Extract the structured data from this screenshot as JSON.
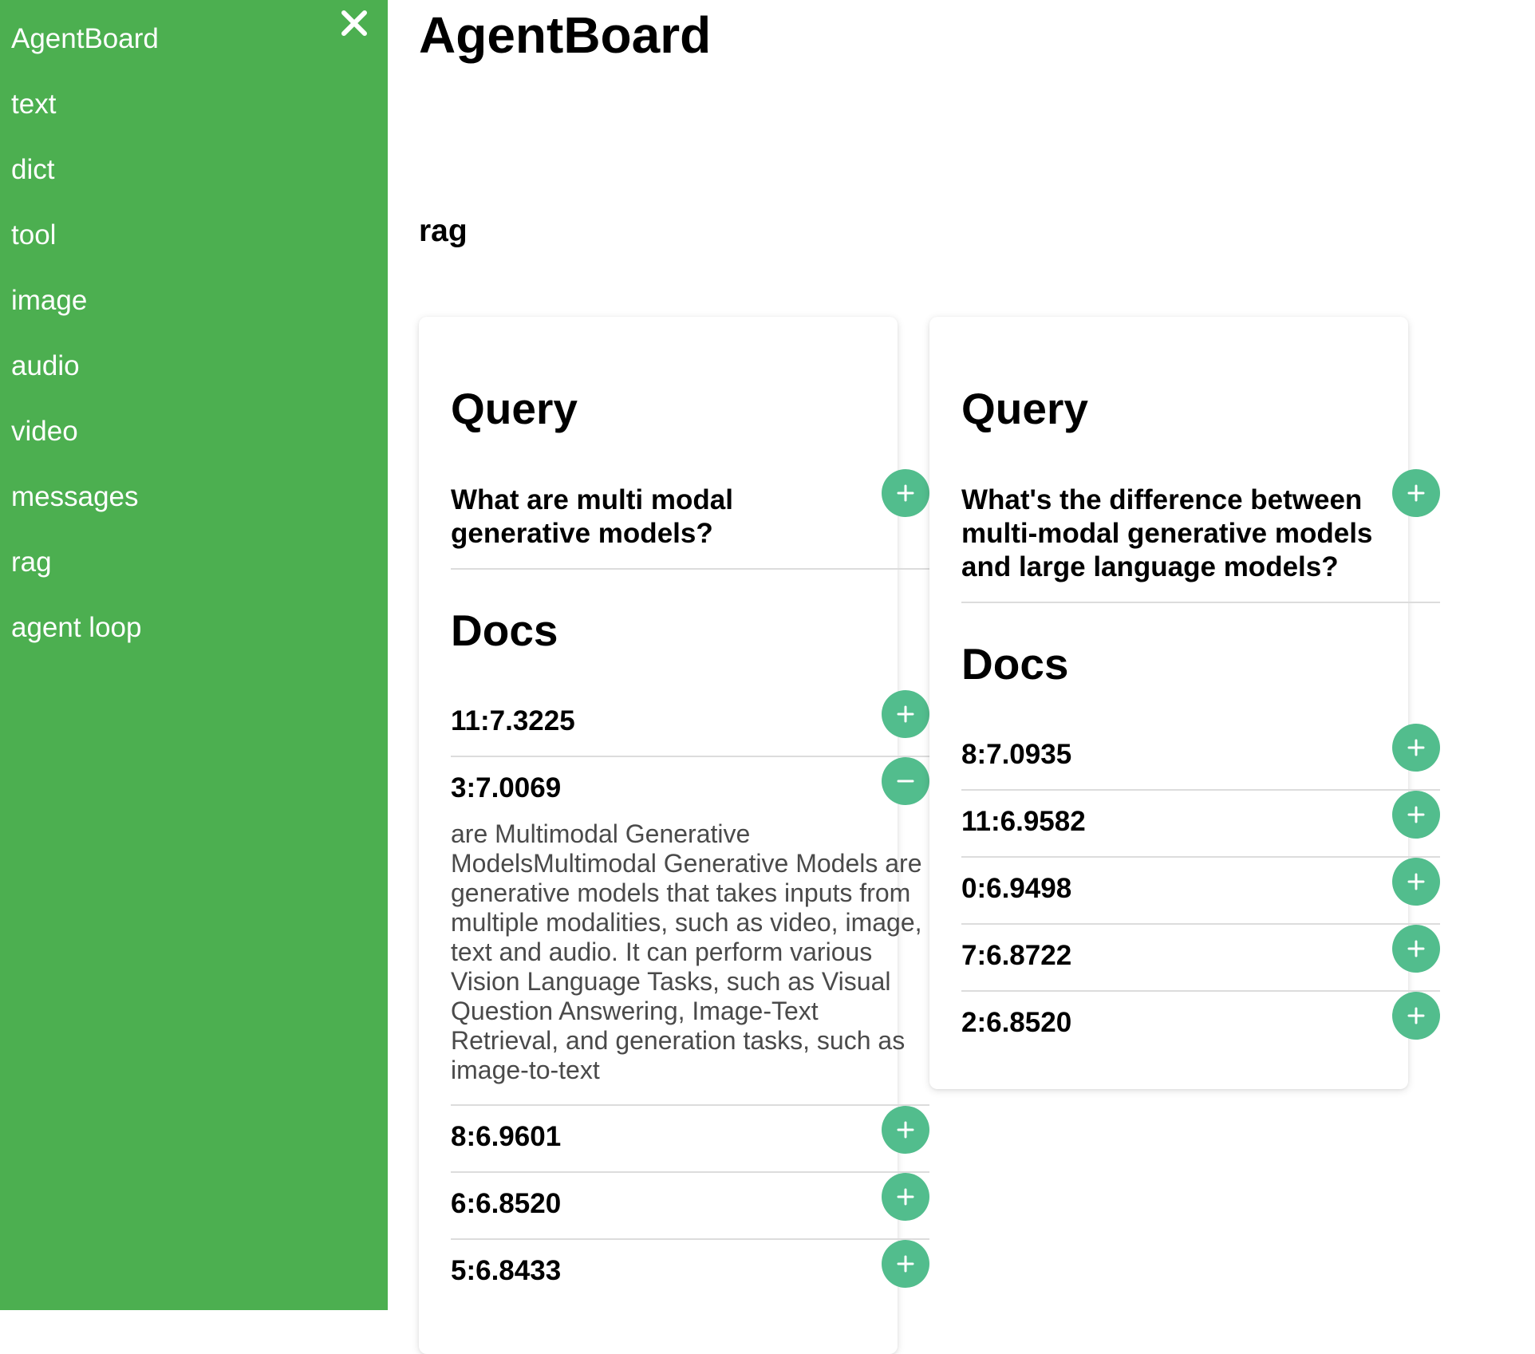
{
  "sidebar": {
    "items": [
      {
        "label": "AgentBoard"
      },
      {
        "label": "text"
      },
      {
        "label": "dict"
      },
      {
        "label": "tool"
      },
      {
        "label": "image"
      },
      {
        "label": "audio"
      },
      {
        "label": "video"
      },
      {
        "label": "messages"
      },
      {
        "label": "rag"
      },
      {
        "label": "agent loop"
      }
    ],
    "close_icon": "close-icon",
    "background": "#4caf50",
    "text_color": "#ffffff"
  },
  "main": {
    "title": "AgentBoard",
    "section": "rag"
  },
  "accent_color": "#52bd8d",
  "cards": [
    {
      "query_heading": "Query",
      "query": "What are multi modal generative models?",
      "docs_heading": "Docs",
      "docs": [
        {
          "id": "11:7.3225",
          "expanded": false
        },
        {
          "id": "3:7.0069",
          "expanded": true,
          "text": "are Multimodal Generative ModelsMultimodal Generative Models are generative models that takes inputs from multiple modalities, such as video, image, text and audio. It can perform various Vision Language Tasks, such as Visual Question Answering, Image-Text Retrieval, and generation tasks, such as image-to-text"
        },
        {
          "id": "8:6.9601",
          "expanded": false
        },
        {
          "id": "6:6.8520",
          "expanded": false
        },
        {
          "id": "5:6.8433",
          "expanded": false
        }
      ]
    },
    {
      "query_heading": "Query",
      "query": "What's the difference between multi-modal generative models and large language models?",
      "docs_heading": "Docs",
      "docs": [
        {
          "id": "8:7.0935",
          "expanded": false
        },
        {
          "id": "11:6.9582",
          "expanded": false
        },
        {
          "id": "0:6.9498",
          "expanded": false
        },
        {
          "id": "7:6.8722",
          "expanded": false
        },
        {
          "id": "2:6.8520",
          "expanded": false
        }
      ]
    }
  ],
  "icons": {
    "expand": "plus-icon",
    "collapse": "minus-icon"
  }
}
